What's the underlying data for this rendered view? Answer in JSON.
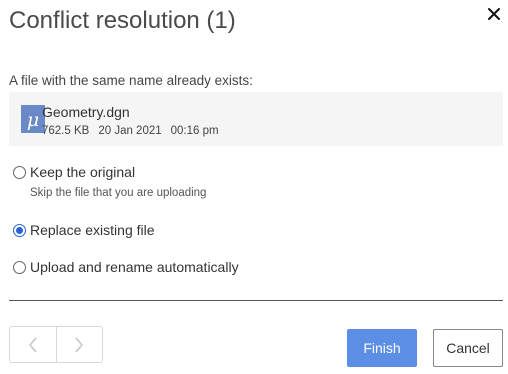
{
  "dialog": {
    "title": "Conflict resolution (1)"
  },
  "conflict": {
    "message": "A file with the same name already exists:",
    "file": {
      "icon": "microstation-file-icon",
      "icon_letter": "M",
      "icon_color": "#6a89c7",
      "name": "Geometry.dgn",
      "size": "762.5 KB",
      "date": "20 Jan 2021",
      "time": "00:16 pm"
    }
  },
  "options": [
    {
      "label": "Keep the original",
      "description": "Skip the file that you are uploading",
      "checked": false
    },
    {
      "label": "Replace existing file",
      "checked": true
    },
    {
      "label": "Upload and rename automatically",
      "checked": false
    }
  ],
  "footer": {
    "finish_label": "Finish",
    "cancel_label": "Cancel",
    "accent_color": "#5b8ee4"
  }
}
